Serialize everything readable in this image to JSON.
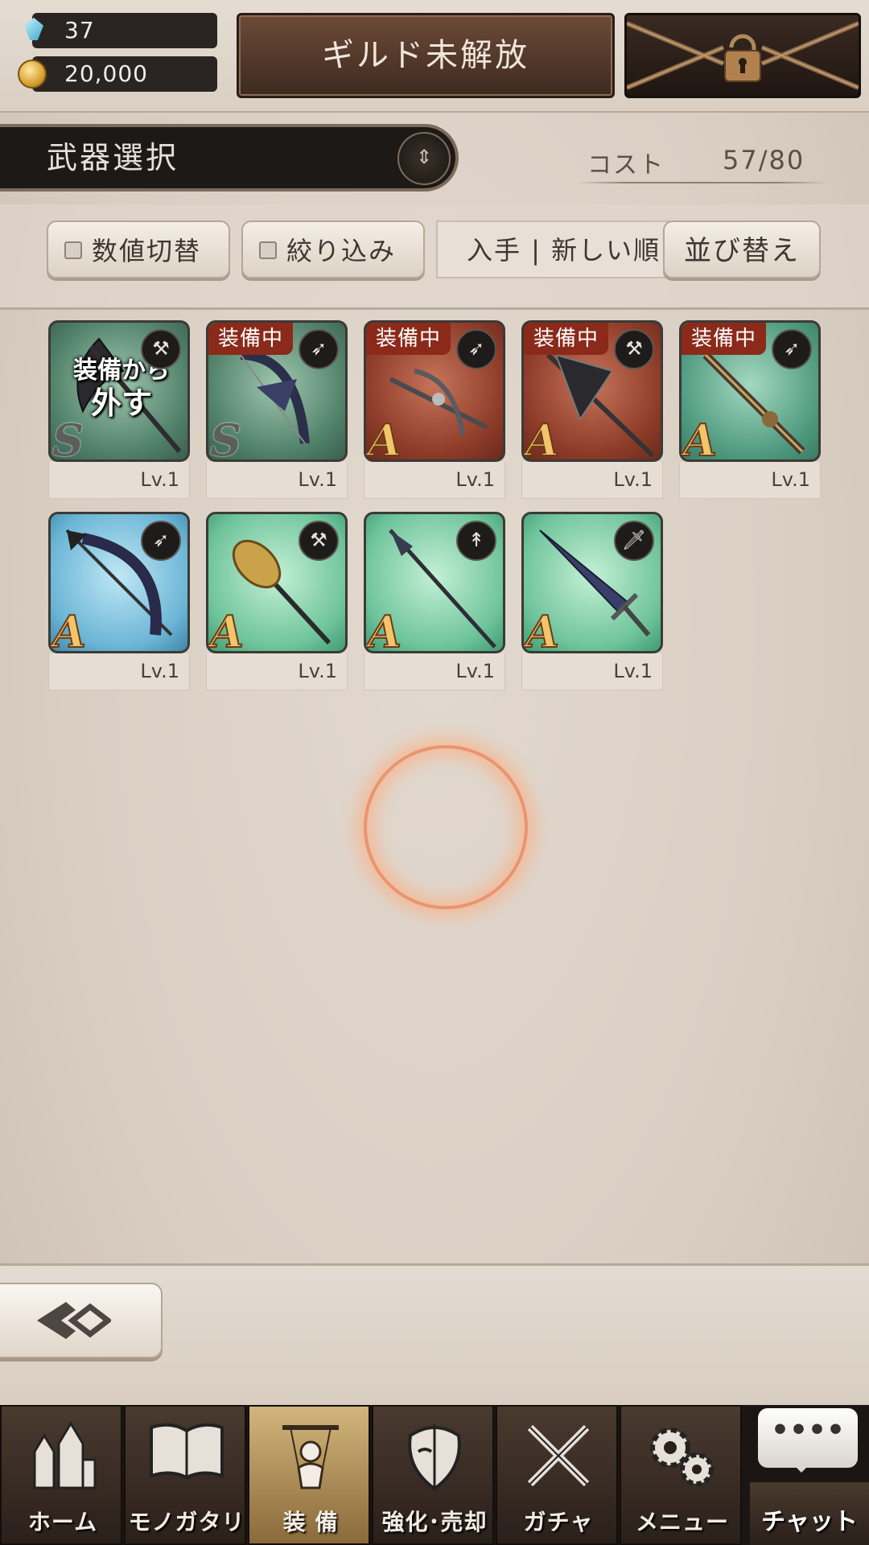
{
  "header": {
    "gem_count": "37",
    "coin_count": "20,000",
    "guild_label": "ギルド未解放"
  },
  "title_bar": {
    "title": "武器選択"
  },
  "cost": {
    "label": "コスト",
    "value": "57/80"
  },
  "filters": {
    "toggle_values_label": "数値切替",
    "narrow_label": "絞り込み",
    "sort_current": "入手 | 新しい順",
    "sort_button_label": "並び替え"
  },
  "weapons": [
    {
      "rank": "S",
      "level": "Lv.1",
      "type_icon": "axe-icon",
      "equipped": false,
      "overlay_line1": "装備から",
      "overlay_line2": "外す",
      "bg": "gray"
    },
    {
      "rank": "S",
      "level": "Lv.1",
      "type_icon": "bow-icon",
      "equipped": true,
      "badge": "装備中",
      "bg": "gray"
    },
    {
      "rank": "A",
      "level": "Lv.1",
      "type_icon": "bow-icon",
      "equipped": true,
      "badge": "装備中",
      "bg": "red"
    },
    {
      "rank": "A",
      "level": "Lv.1",
      "type_icon": "axe-icon",
      "equipped": true,
      "badge": "装備中",
      "bg": "red"
    },
    {
      "rank": "A",
      "level": "Lv.1",
      "type_icon": "bow-icon",
      "equipped": true,
      "badge": "装備中",
      "bg": "green"
    },
    {
      "rank": "A",
      "level": "Lv.1",
      "type_icon": "bow-icon",
      "equipped": false,
      "bg": "blue"
    },
    {
      "rank": "A",
      "level": "Lv.1",
      "type_icon": "hammer-icon",
      "equipped": false,
      "bg": "mint"
    },
    {
      "rank": "A",
      "level": "Lv.1",
      "type_icon": "spear-icon",
      "equipped": false,
      "bg": "mint"
    },
    {
      "rank": "A",
      "level": "Lv.1",
      "type_icon": "sword-icon",
      "equipped": false,
      "bg": "mint"
    }
  ],
  "nav": {
    "items": [
      {
        "label": "ホーム",
        "icon": "castle-icon",
        "active": false
      },
      {
        "label": "モノガタリ",
        "icon": "book-icon",
        "active": false
      },
      {
        "label": "装 備",
        "icon": "puppet-icon",
        "active": true
      },
      {
        "label": "強化･売却",
        "icon": "mask-icon",
        "active": false
      },
      {
        "label": "ガチャ",
        "icon": "crossed-swords-icon",
        "active": false
      },
      {
        "label": "メニュー",
        "icon": "gears-icon",
        "active": false
      }
    ],
    "chat_label": "チャット",
    "chat_bubble_text": "••••"
  }
}
